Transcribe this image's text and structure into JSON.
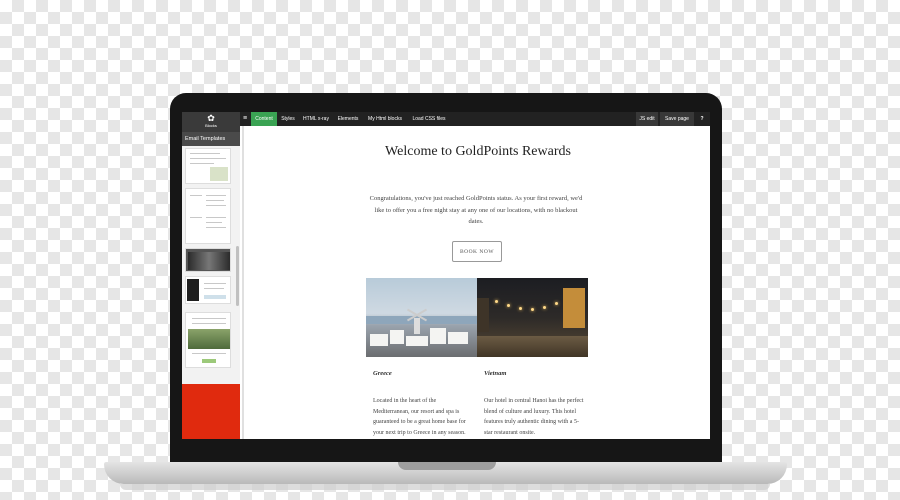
{
  "sidebar": {
    "logo_label": "Blocks",
    "section_title": "Email Templates"
  },
  "toolbar": {
    "menu_icon": "≡",
    "items": [
      "Content",
      "Styles",
      "HTML x-ray",
      "Elements",
      "My Html blocks",
      "Load CSS files"
    ],
    "right_items": [
      "JS edit",
      "Save page"
    ],
    "help_icon": "?"
  },
  "email": {
    "title": "Welcome to GoldPoints Rewards",
    "intro": "Congratulations, you've just reached GoldPoints status. As your first reward, we'd like to offer you a free night stay at any one of our locations, with no blackout dates.",
    "button": "BOOK NOW",
    "columns": [
      {
        "heading": "Greece",
        "text": "Located in the heart of the Mediterranean, our resort and spa is guaranteed to be a great home base for your next trip to Greece in any season."
      },
      {
        "heading": "Vietnam",
        "text": "Our hotel in central Hanoi has the perfect blend of culture and luxury. This hotel features truly authentic dining with a 5-star restaurant onsite."
      }
    ]
  },
  "colors": {
    "active_tab": "#3aa353",
    "toolbar_bg": "#222222",
    "sidebar_accent": "#e02a0e"
  }
}
